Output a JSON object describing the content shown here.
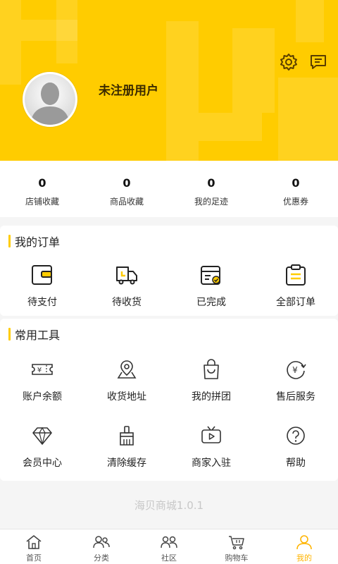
{
  "header": {
    "username": "未注册用户",
    "bg_color": "#ffcc00",
    "icons": [
      "settings-icon",
      "message-icon"
    ]
  },
  "stats": [
    {
      "value": "0",
      "label": "店铺收藏"
    },
    {
      "value": "0",
      "label": "商品收藏"
    },
    {
      "value": "0",
      "label": "我的足迹"
    },
    {
      "value": "0",
      "label": "优惠券"
    }
  ],
  "orders": {
    "title": "我的订单",
    "items": [
      {
        "label": "待支付",
        "icon": "wallet-icon"
      },
      {
        "label": "待收货",
        "icon": "truck-icon"
      },
      {
        "label": "已完成",
        "icon": "completed-box-icon"
      },
      {
        "label": "全部订单",
        "icon": "clipboard-icon"
      }
    ]
  },
  "tools": {
    "title": "常用工具",
    "items": [
      {
        "label": "账户余额",
        "icon": "ticket-yen-icon"
      },
      {
        "label": "收货地址",
        "icon": "map-pin-icon"
      },
      {
        "label": "我的拼团",
        "icon": "shopping-bag-icon"
      },
      {
        "label": "售后服务",
        "icon": "yen-refund-icon"
      },
      {
        "label": "会员中心",
        "icon": "diamond-icon"
      },
      {
        "label": "清除缓存",
        "icon": "broom-icon"
      },
      {
        "label": "商家入驻",
        "icon": "tv-play-icon"
      },
      {
        "label": "帮助",
        "icon": "help-icon"
      }
    ]
  },
  "version": "海贝商城1.0.1",
  "tabbar": {
    "items": [
      {
        "label": "首页",
        "icon": "home-icon"
      },
      {
        "label": "分类",
        "icon": "users-icon"
      },
      {
        "label": "社区",
        "icon": "community-icon"
      },
      {
        "label": "购物车",
        "icon": "cart-icon"
      },
      {
        "label": "我的",
        "icon": "profile-icon"
      }
    ],
    "active_index": 4,
    "active_color": "#ffb400"
  }
}
